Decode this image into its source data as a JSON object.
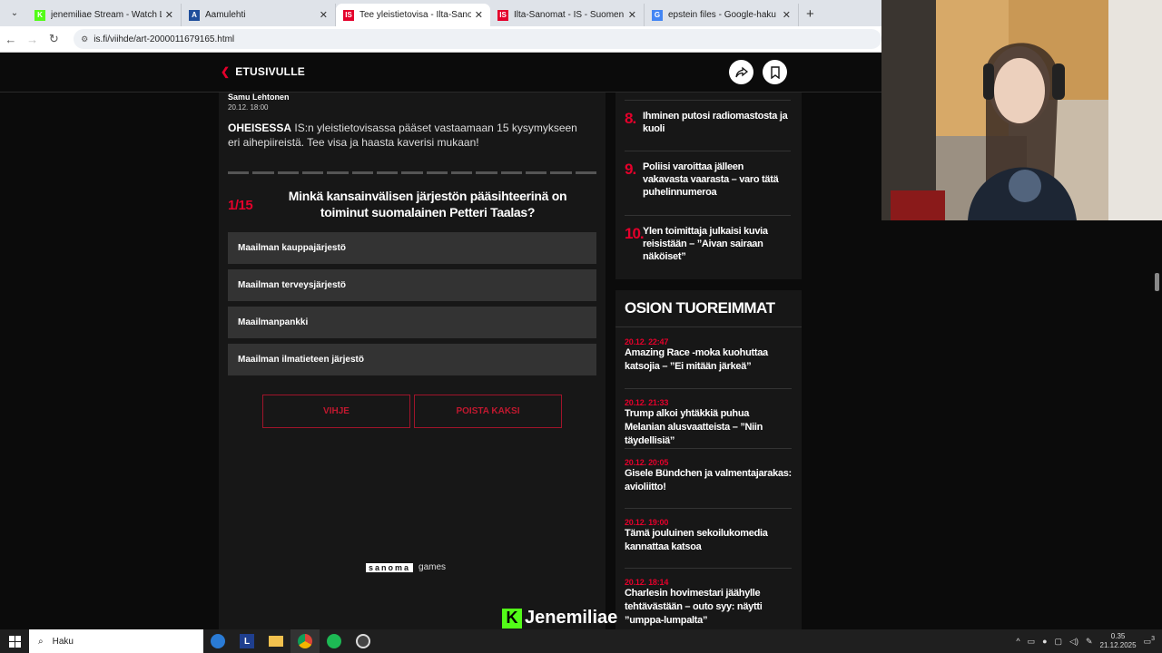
{
  "browser": {
    "tabs": [
      {
        "label": "jenemiliae Stream - Watch Live",
        "favicon": "K",
        "color": "#53fc18",
        "active": false
      },
      {
        "label": "Aamulehti",
        "favicon": "A",
        "color": "#1f4e9b",
        "active": false
      },
      {
        "label": "Tee yleistietovisa - Ilta-Sanomat",
        "favicon": "IS",
        "color": "#e4002b",
        "active": true
      },
      {
        "label": "Ilta-Sanomat - IS - Suomen suu",
        "favicon": "IS",
        "color": "#e4002b",
        "active": false
      },
      {
        "label": "epstein files - Google-haku",
        "favicon": "G",
        "color": "#4285f4",
        "active": false
      }
    ],
    "url": "is.fi/viihde/art-2000011679165.html"
  },
  "nav": {
    "back_label": "ETUSIVULLE"
  },
  "article": {
    "author": "Samu Lehtonen",
    "date": "20.12. 18:00",
    "lead_bold": "OHEISESSA",
    "lead_text": " IS:n yleistietovisassa pääset vastaamaan 15 kysymykseen eri aihepiireistä. Tee visa ja haasta kaverisi mukaan!",
    "progress_total": 15,
    "question_number": "1/15",
    "question": "Minkä kansainvälisen järjestön pääsihteerinä on toiminut suomalainen Petteri Taalas?",
    "answers": [
      "Maailman kauppajärjestö",
      "Maailman terveysjärjestö",
      "Maailmanpankki",
      "Maailman ilmatieteen järjestö"
    ],
    "hint_label": "VIHJE",
    "remove_two_label": "POISTA KAKSI",
    "brand": "sanoma",
    "brand_suffix": "games"
  },
  "popular": [
    {
      "n": "8.",
      "title": "Ihminen putosi radiomastosta ja kuoli"
    },
    {
      "n": "9.",
      "title": "Poliisi varoittaa jälleen vakavasta vaarasta – varo tätä puhelin­numeroa"
    },
    {
      "n": "10.",
      "title": "Ylen toimittaja julkaisi kuvia reisistään – ”Aivan sairaan näköiset”"
    }
  ],
  "latest": {
    "heading": "OSION TUOREIMMAT",
    "items": [
      {
        "time": "20.12. 22:47",
        "title": "Amazing Race -moka kuohuttaa katsojia – ”Ei mitään järkeä”"
      },
      {
        "time": "20.12. 21:33",
        "title": "Trump alkoi yhtäkkiä puhua Melanian alusvaatteista – ”Niin täydellisiä”"
      },
      {
        "time": "20.12. 20:05",
        "title": "Gisele Bündchen ja valmentajarakas: avioliitto!"
      },
      {
        "time": "20.12. 19:00",
        "title": "Tämä jouluinen sekoilukomedia kannattaa katsoa"
      },
      {
        "time": "20.12. 18:14",
        "title": "Charlesin hovimestari jäähylle tehtävästään – outo syy: näytti ”umppa-lumpalta”"
      }
    ]
  },
  "overlay": {
    "name": "Jenemiliae"
  },
  "taskbar": {
    "search": "Haku",
    "time": "0.35",
    "date": "21.12.2025",
    "notifications": "3"
  }
}
